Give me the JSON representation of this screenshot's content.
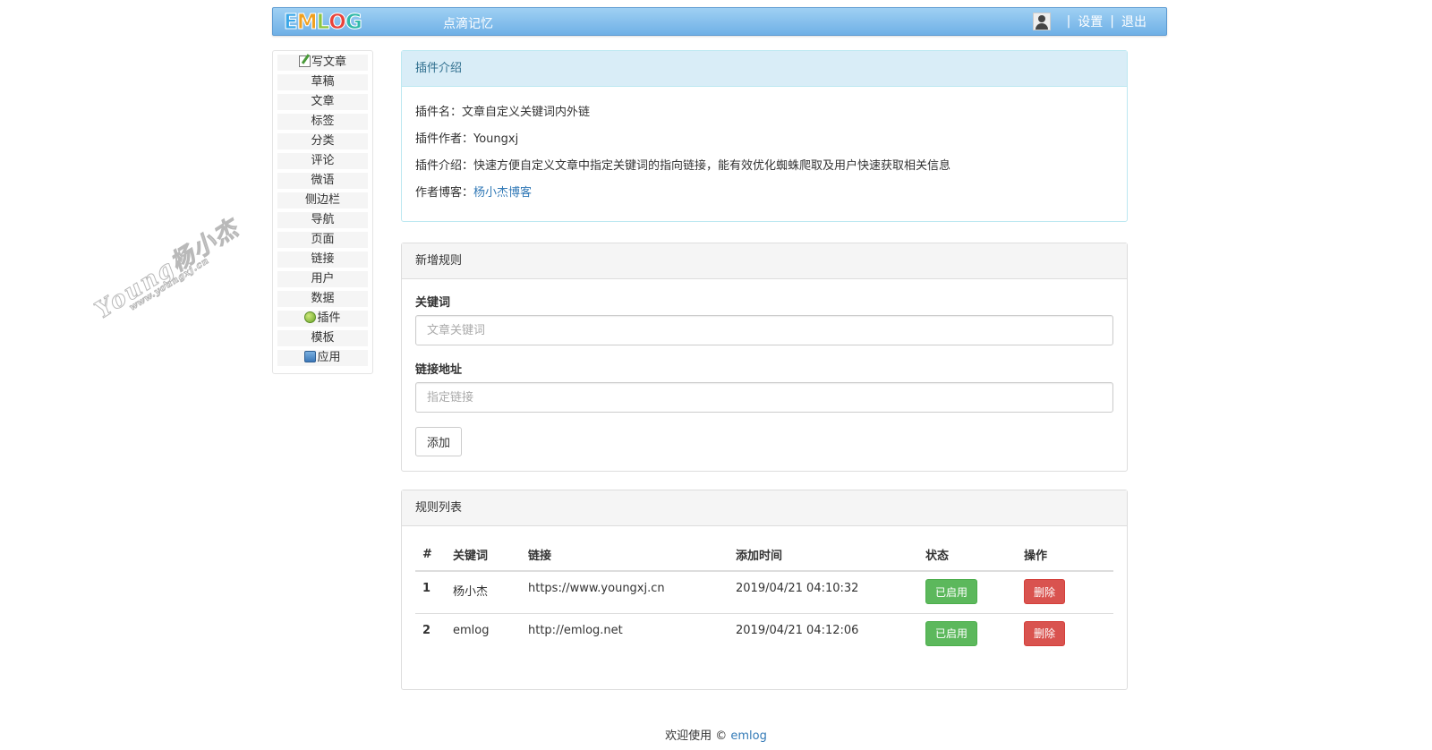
{
  "header": {
    "logo_letters": [
      {
        "char": "E",
        "color": "#3aa7e8"
      },
      {
        "char": "M",
        "color": "#f0a020"
      },
      {
        "char": "L",
        "color": "#8cc63f"
      },
      {
        "char": "O",
        "color": "#e8433a"
      },
      {
        "char": "G",
        "color": "#2fb8a8"
      }
    ],
    "site_title": "点滴记忆",
    "separator": "|",
    "settings_label": "设置",
    "logout_label": "退出"
  },
  "sidebar": {
    "items": [
      {
        "label": "写文章",
        "icon": "write-icon"
      },
      {
        "label": "草稿"
      },
      {
        "label": "文章"
      },
      {
        "label": "标签"
      },
      {
        "label": "分类"
      },
      {
        "label": "评论"
      },
      {
        "label": "微语"
      },
      {
        "label": "侧边栏"
      },
      {
        "label": "导航"
      },
      {
        "label": "页面"
      },
      {
        "label": "链接"
      },
      {
        "label": "用户"
      },
      {
        "label": "数据"
      },
      {
        "label": "插件",
        "icon": "plugin-icon"
      },
      {
        "label": "模板"
      },
      {
        "label": "应用",
        "icon": "app-icon"
      }
    ]
  },
  "watermark": {
    "main": "Young杨小杰",
    "sub": "www.youngxj.cn"
  },
  "info_panel": {
    "title": "插件介绍",
    "name_label": "插件名：",
    "name_value": "文章自定义关键词内外链",
    "author_label": "插件作者：",
    "author_value": "Youngxj",
    "intro_label": "插件介绍：",
    "intro_value": "快速方便自定义文章中指定关键词的指向链接，能有效优化蜘蛛爬取及用户快速获取相关信息",
    "blog_label": "作者博客：",
    "blog_link": "杨小杰博客"
  },
  "add_panel": {
    "title": "新增规则",
    "keyword_label": "关键词",
    "keyword_placeholder": "文章关键词",
    "url_label": "链接地址",
    "url_placeholder": "指定链接",
    "add_button": "添加"
  },
  "list_panel": {
    "title": "规则列表",
    "columns": [
      "#",
      "关键词",
      "链接",
      "添加时间",
      "状态",
      "操作"
    ],
    "rows": [
      {
        "num": "1",
        "keyword": "杨小杰",
        "link": "https://www.youngxj.cn",
        "time": "2019/04/21 04:10:32",
        "status": "已启用",
        "action": "删除"
      },
      {
        "num": "2",
        "keyword": "emlog",
        "link": "http://emlog.net",
        "time": "2019/04/21 04:12:06",
        "status": "已启用",
        "action": "删除"
      }
    ]
  },
  "footer": {
    "text": "欢迎使用 ©",
    "link": "emlog"
  }
}
